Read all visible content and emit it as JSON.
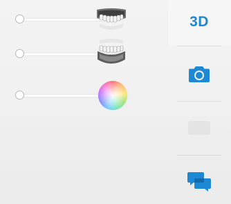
{
  "sliders": [
    {
      "name": "upper-jaw-opacity",
      "thumbnail_icon": "upper-teeth-icon"
    },
    {
      "name": "lower-jaw-opacity",
      "thumbnail_icon": "lower-teeth-icon"
    },
    {
      "name": "color-adjust",
      "thumbnail_icon": "color-wheel-icon"
    }
  ],
  "toolbar": {
    "view_3d_label": "3D",
    "camera_icon": "camera-icon",
    "disabled_icon": "placeholder-icon",
    "chat_icon": "chat-bubbles-icon"
  },
  "colors": {
    "accent": "#1d88d4",
    "background": "#f1f1f1",
    "disabled_icon": "#e2e2e2"
  }
}
